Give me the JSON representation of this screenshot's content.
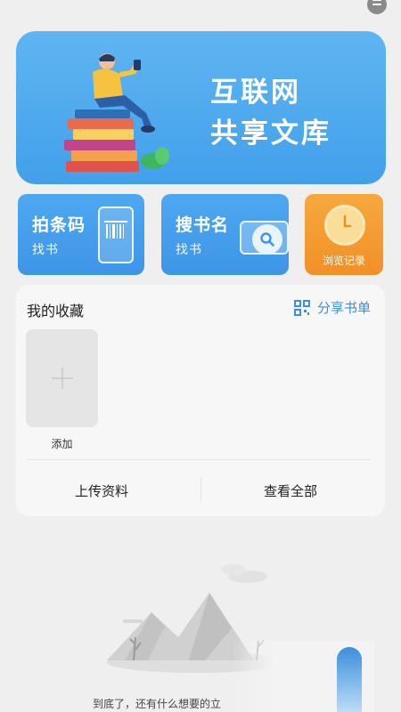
{
  "banner": {
    "title_line1": "互联网",
    "title_line2": "共享文库",
    "color": "#4fa9ef"
  },
  "quick_actions": [
    {
      "title": "拍条码",
      "subtitle": "找书",
      "icon": "barcode-icon"
    },
    {
      "title": "搜书名",
      "subtitle": "找书",
      "icon": "search-icon"
    },
    {
      "title": "浏览记录",
      "icon": "clock-icon"
    }
  ],
  "favorites": {
    "title": "我的收藏",
    "share_label": "分享书单",
    "share_icon": "qrcode-icon",
    "add_label": "添加",
    "upload_label": "上传资料",
    "view_all_label": "查看全部"
  },
  "footer": {
    "end_text": "到底了，还有什么想要的立"
  },
  "colors": {
    "primary_blue": "#3e95e6",
    "orange": "#f19027",
    "link_blue": "#3c8fdc",
    "background": "#efefef"
  }
}
